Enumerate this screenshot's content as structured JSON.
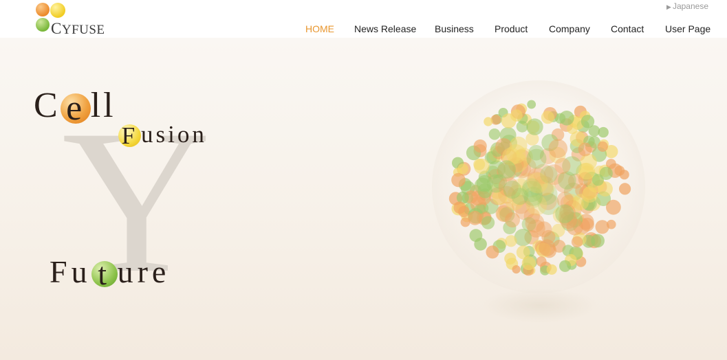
{
  "brand": {
    "logo_text": "CYFUSE",
    "logo_initial": "C",
    "logo_rest": "YFUSE"
  },
  "lang_switch": {
    "label": "Japanese"
  },
  "nav": {
    "items": [
      {
        "label": "HOME",
        "active": true
      },
      {
        "label": "News Release",
        "active": false
      },
      {
        "label": "Business",
        "active": false
      },
      {
        "label": "Product",
        "active": false
      },
      {
        "label": "Company",
        "active": false
      },
      {
        "label": "Contact",
        "active": false
      },
      {
        "label": "User Page",
        "active": false
      }
    ]
  },
  "hero": {
    "cell": {
      "pre": "C",
      "ball": "e",
      "post": "ll"
    },
    "fusion": {
      "ball": "F",
      "post": "usion"
    },
    "future": {
      "pre": "Fu",
      "ball": "t",
      "post": "ure"
    },
    "big_letter": "Y"
  },
  "colors": {
    "accent": "#e8962e",
    "orb_orange": "#f0a360",
    "orb_yellow": "#f3d86a",
    "orb_green": "#9cc96a"
  },
  "icons": [
    "triangle-right-icon",
    "cell-cluster-icon"
  ]
}
